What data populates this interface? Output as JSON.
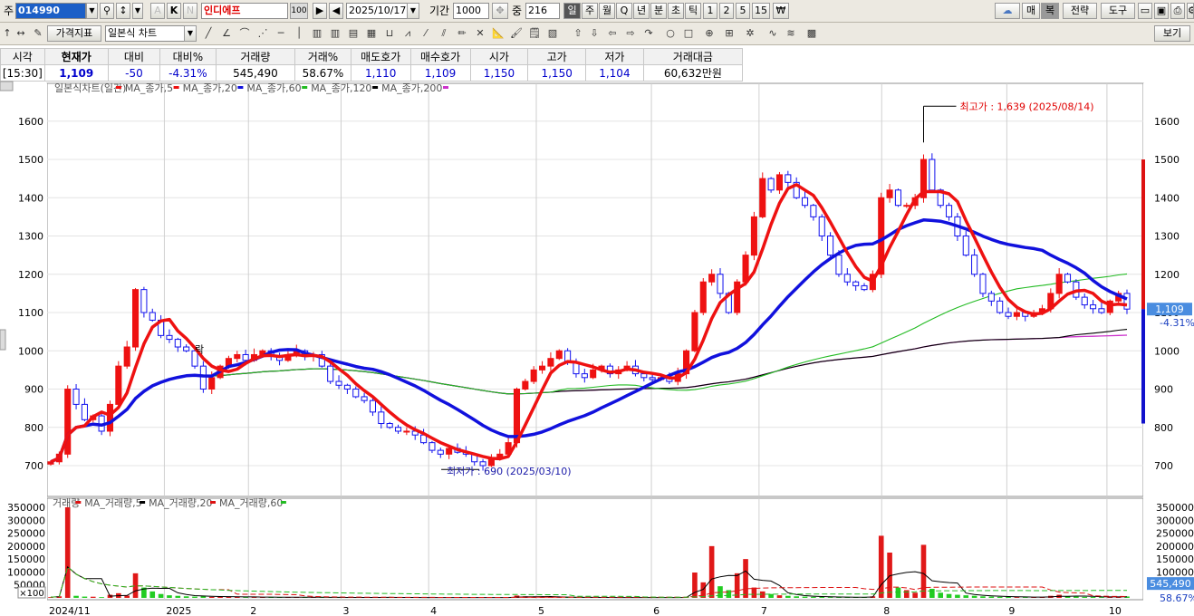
{
  "toolbar1": {
    "market": "주",
    "code": "014990",
    "name": "인디에프",
    "name_badge": "100",
    "date": "2025/10/17",
    "period_label": "기간",
    "period_value": "1000",
    "count_label": "중",
    "count_value": "216",
    "k_btn": "K",
    "n_btn": "N",
    "a_btn": "A",
    "interval_tabs": [
      "일",
      "주",
      "월",
      "Q",
      "년",
      "분",
      "초",
      "틱",
      "1",
      "2",
      "5",
      "15"
    ],
    "right_buttons": {
      "buy": "매",
      "copy": "복",
      "strategy": "전략",
      "tools": "도구"
    }
  },
  "toolbar2": {
    "indicator_btn": "가격지표",
    "chart_type": "일본식 차트",
    "view_btn": "보기"
  },
  "quote": {
    "headers": [
      "시각",
      "현재가",
      "대비",
      "대비%",
      "거래량",
      "거래%",
      "매도호가",
      "매수호가",
      "시가",
      "고가",
      "저가",
      "거래대금"
    ],
    "values": [
      "[15:30]",
      "1,109",
      "-50",
      "-4.31%",
      "545,490",
      "58.67%",
      "1,110",
      "1,109",
      "1,150",
      "1,150",
      "1,104",
      "60,632만원"
    ]
  },
  "chart_data": {
    "type": "candlestick",
    "legend": {
      "price_title": "일본식차트(일간)",
      "ma5": "MA_종가,5",
      "ma20": "MA_종가,20",
      "ma60": "MA_종가,60",
      "ma120": "MA_종가,120",
      "ma200": "MA_종가,200",
      "vol_title": "거래량",
      "vol_ma5": "MA_거래량,5",
      "vol_ma20": "MA_거래량,20",
      "vol_ma60": "MA_거래량,60"
    },
    "colors": {
      "up": "#ee1111",
      "down": "#1111ee",
      "ma5": "#ee1111",
      "ma20": "#1111dd",
      "ma60": "#22bb22",
      "ma120": "#000000",
      "ma200": "#cc33cc"
    },
    "price_axis": {
      "min": 650,
      "max": 1650,
      "ticks": [
        700,
        800,
        900,
        1000,
        1100,
        1200,
        1300,
        1400,
        1500,
        1600
      ]
    },
    "volume_axis": {
      "ticks": [
        350000,
        300000,
        250000,
        200000,
        150000,
        100000,
        50000
      ],
      "tick_labels": [
        "350000",
        "300000",
        "250000",
        "200000",
        "150000",
        "100000",
        "50000"
      ]
    },
    "volume_multiplier": "×100",
    "x_labels": [
      "2024/11",
      "2025",
      "2",
      "3",
      "4",
      "5",
      "6",
      "7",
      "8",
      "9",
      "10"
    ],
    "annotations": {
      "high": {
        "label": "최고가 : 1,639 (2025/08/14)",
        "value": 1639
      },
      "low": {
        "label": "최저가 : 690 (2025/03/10)",
        "value": 690
      },
      "lock_label": "락"
    },
    "last_price": {
      "value": 1109,
      "label": "1,109",
      "pct": "-4.31%"
    },
    "last_volume": {
      "label": "545,490",
      "pct": "58.67%"
    },
    "close": [
      710,
      730,
      900,
      860,
      820,
      830,
      790,
      860,
      960,
      1010,
      1160,
      1100,
      1080,
      1040,
      1030,
      1010,
      1000,
      960,
      900,
      930,
      960,
      980,
      990,
      975,
      990,
      1000,
      985,
      975,
      990,
      1000,
      985,
      990,
      960,
      920,
      910,
      900,
      880,
      870,
      840,
      810,
      800,
      790,
      790,
      780,
      760,
      740,
      730,
      745,
      735,
      730,
      710,
      700,
      720,
      730,
      760,
      900,
      920,
      950,
      960,
      980,
      1000,
      970,
      940,
      930,
      950,
      960,
      940,
      950,
      960,
      940,
      930,
      925,
      930,
      920,
      940,
      1000,
      1100,
      1180,
      1200,
      1150,
      1100,
      1180,
      1250,
      1350,
      1450,
      1420,
      1460,
      1440,
      1400,
      1380,
      1350,
      1300,
      1250,
      1200,
      1180,
      1170,
      1160,
      1200,
      1400,
      1420,
      1380,
      1380,
      1400,
      1500,
      1420,
      1380,
      1350,
      1300,
      1250,
      1200,
      1150,
      1130,
      1100,
      1090,
      1100,
      1090,
      1100,
      1110,
      1150,
      1200,
      1180,
      1140,
      1120,
      1110,
      1100,
      1130,
      1150,
      1109
    ],
    "volume": [
      3000,
      6000,
      350000,
      8000,
      5000,
      4500,
      3000,
      12000,
      18000,
      9000,
      95000,
      40000,
      25000,
      15000,
      10000,
      8000,
      6000,
      5000,
      7000,
      4000,
      5000,
      4000,
      3500,
      3000,
      3000,
      2500,
      3000,
      2000,
      2500,
      3000,
      2000,
      2000,
      2500,
      1500,
      2000,
      1500,
      2000,
      1500,
      2000,
      2500,
      1800,
      1500,
      1600,
      1500,
      1400,
      1300,
      1200,
      1500,
      1400,
      1300,
      1600,
      1500,
      1400,
      1300,
      1800,
      9000,
      6000,
      4000,
      3500,
      3000,
      2500,
      2000,
      1800,
      2000,
      1500,
      1400,
      1600,
      1300,
      1500,
      1400,
      1200,
      1100,
      1500,
      1200,
      1300,
      4000,
      98000,
      60000,
      200000,
      45000,
      30000,
      95000,
      150000,
      40000,
      25000,
      15000,
      10000,
      8000,
      6000,
      5000,
      4000,
      3500,
      3000,
      2500,
      3000,
      2500,
      2800,
      6000,
      240000,
      175000,
      40000,
      30000,
      20000,
      205000,
      35000,
      20000,
      15000,
      12000,
      10000,
      8000,
      6000,
      5000,
      4000,
      3500,
      3000,
      3000,
      2800,
      3200,
      8000,
      12000,
      6000,
      5000,
      4000,
      3500,
      3000,
      4000,
      5000,
      5454
    ]
  }
}
